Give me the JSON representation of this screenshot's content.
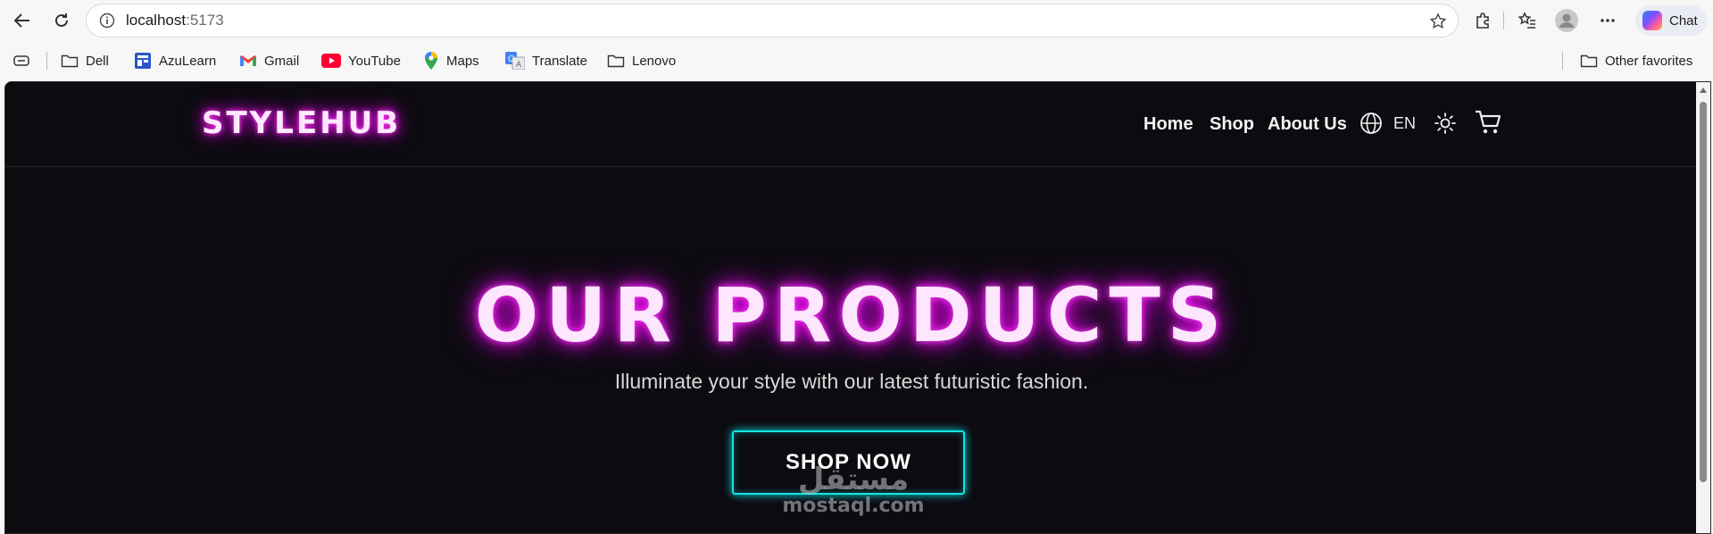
{
  "browser": {
    "url_host": "localhost",
    "url_port": ":5173",
    "chat_label": "Chat"
  },
  "bookmarks": [
    {
      "label": "Dell",
      "icon": "folder-icon"
    },
    {
      "label": "AzuLearn",
      "icon": "azulearn-icon"
    },
    {
      "label": "Gmail",
      "icon": "gmail-icon"
    },
    {
      "label": "YouTube",
      "icon": "youtube-icon"
    },
    {
      "label": "Maps",
      "icon": "maps-icon"
    },
    {
      "label": "Translate",
      "icon": "translate-icon"
    },
    {
      "label": "Lenovo",
      "icon": "folder-icon"
    }
  ],
  "other_favorites": "Other favorites",
  "site": {
    "logo": "STYLEHUB",
    "nav": {
      "home": "Home",
      "shop": "Shop",
      "about": "About Us",
      "lang": "EN"
    },
    "hero": {
      "title": "OUR PRODUCTS",
      "subtitle": "Illuminate your style with our latest futuristic fashion.",
      "cta": "SHOP NOW"
    },
    "watermark": {
      "arabic": "مستقل",
      "latin": "mostaql.com"
    }
  },
  "colors": {
    "background": "#0c0b10",
    "neon_pink": "#e800e8",
    "neon_cyan": "#12e4e4"
  }
}
